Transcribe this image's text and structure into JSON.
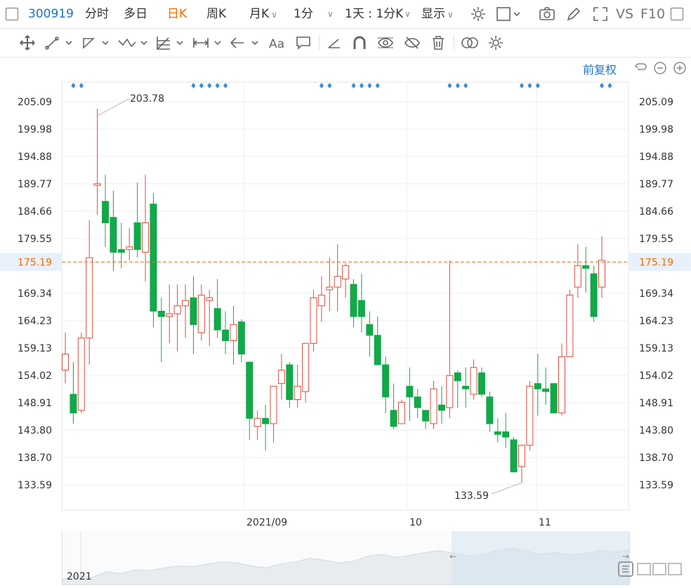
{
  "toolbar": {
    "code": "300919",
    "tabs": [
      "分时",
      "多日",
      "日K",
      "周K",
      "月K"
    ],
    "active_tab": "日K",
    "interval": "1分",
    "period": "1天 : 1分K",
    "display": "显示",
    "vs": "VS",
    "f10": "F10"
  },
  "adjust_label": "前复权",
  "icons": {
    "row1": [
      "settings-icon",
      "square-icon",
      "camera-icon",
      "pencil-icon",
      "expand-icon"
    ],
    "row2": [
      "move-icon",
      "line-tool-icon",
      "polyline-tool-icon",
      "wave-tool-icon",
      "fib-tool-icon",
      "measure-tool-icon",
      "arrow-tool-icon",
      "text-tool-icon",
      "comment-tool-icon",
      "ruler-icon",
      "magnet-icon",
      "eye-icon",
      "hide-icon",
      "trash-icon",
      "link-icon",
      "gear-icon"
    ]
  },
  "colors": {
    "up": "#e04a3f",
    "down": "#13a84a",
    "current": "#f56a00",
    "dots": "#2a8ff0"
  },
  "chart_data": {
    "type": "candlestick",
    "y_ticks": [
      "205.09",
      "199.98",
      "194.88",
      "189.77",
      "184.66",
      "179.55",
      "169.34",
      "164.23",
      "159.13",
      "154.02",
      "148.91",
      "143.80",
      "138.70",
      "133.59"
    ],
    "ylim": [
      133.59,
      205.09
    ],
    "current_price": "175.19",
    "x_labels": [
      "2021/09",
      "10",
      "11"
    ],
    "nav_year": "2021",
    "max_annotation": "203.78",
    "min_annotation": "133.59",
    "candles": [
      [
        155,
        158,
        162,
        152.5
      ],
      [
        150.5,
        147,
        156.5,
        145
      ],
      [
        147.5,
        161,
        162,
        147
      ],
      [
        161,
        176,
        183,
        156
      ],
      [
        189.5,
        189.8,
        203.8,
        184
      ],
      [
        186.5,
        182.5,
        191.5,
        178
      ],
      [
        183.5,
        177,
        188.5,
        173.5
      ],
      [
        177.5,
        177,
        182.5,
        174
      ],
      [
        177.5,
        178,
        181.5,
        175.5
      ],
      [
        182.5,
        177.5,
        190,
        176
      ],
      [
        177,
        182.5,
        191.5,
        171.5
      ],
      [
        186,
        166,
        188,
        163
      ],
      [
        166,
        165,
        168.5,
        156.5
      ],
      [
        165,
        165.5,
        171,
        160
      ],
      [
        165.5,
        167,
        171,
        158.5
      ],
      [
        167,
        168,
        171,
        161
      ],
      [
        168.5,
        163.5,
        172.5,
        158
      ],
      [
        162,
        169,
        171,
        160.5
      ],
      [
        168,
        168.5,
        170,
        159.5
      ],
      [
        166.5,
        162.5,
        172,
        161
      ],
      [
        162.5,
        160.5,
        166,
        158
      ],
      [
        160.5,
        163.5,
        167,
        156
      ],
      [
        164,
        158,
        164.5,
        156.5
      ],
      [
        156.5,
        146,
        156.5,
        142
      ],
      [
        144.5,
        146,
        147.5,
        142
      ],
      [
        146,
        145,
        148.5,
        140
      ],
      [
        145,
        152,
        152,
        141.5
      ],
      [
        152.5,
        155,
        158,
        149.5
      ],
      [
        156,
        149.5,
        156.5,
        148
      ],
      [
        149.5,
        152,
        156,
        148
      ],
      [
        151,
        160,
        160,
        149
      ],
      [
        160,
        168.5,
        170,
        158.5
      ],
      [
        167,
        169,
        172.5,
        164
      ],
      [
        170,
        170.5,
        176,
        166
      ],
      [
        170.5,
        172.5,
        178.5,
        166
      ],
      [
        172,
        174.5,
        175,
        168.5
      ],
      [
        171,
        165,
        172,
        163
      ],
      [
        168,
        165,
        173,
        162
      ],
      [
        163.5,
        161.5,
        166,
        157.5
      ],
      [
        161.5,
        156,
        165,
        156
      ],
      [
        156,
        150,
        157.5,
        147
      ],
      [
        147.5,
        144.5,
        152.5,
        144
      ],
      [
        145,
        149,
        149.5,
        145
      ],
      [
        152,
        150,
        155.5,
        145.5
      ],
      [
        150,
        148,
        151.5,
        146
      ],
      [
        147.5,
        145.5,
        147.5,
        144
      ],
      [
        145,
        151.5,
        153,
        144
      ],
      [
        148.5,
        147.5,
        152,
        145
      ],
      [
        148,
        154,
        175.5,
        146
      ],
      [
        154.5,
        153,
        155,
        148
      ],
      [
        152,
        151.5,
        155.5,
        148
      ],
      [
        150.5,
        155.5,
        157,
        149.5
      ],
      [
        154.5,
        150.5,
        155.5,
        150
      ],
      [
        150,
        145,
        151,
        143.5
      ],
      [
        143.5,
        143,
        146,
        141.5
      ],
      [
        143.5,
        142.5,
        147,
        140.5
      ],
      [
        142,
        136,
        142.5,
        136
      ],
      [
        137,
        141,
        141,
        134
      ],
      [
        141,
        152,
        153,
        140
      ],
      [
        152.5,
        151.5,
        158,
        146.5
      ],
      [
        151.5,
        151,
        155.5,
        148.5
      ],
      [
        152.5,
        147,
        152.5,
        147
      ],
      [
        147,
        157.5,
        160,
        146.5
      ],
      [
        157.5,
        169,
        170,
        158
      ],
      [
        170.5,
        174.5,
        178.5,
        168.5
      ],
      [
        174.5,
        174,
        178,
        169.5
      ],
      [
        173,
        165,
        174.5,
        164
      ],
      [
        170.5,
        175.5,
        180,
        168.5
      ]
    ],
    "signal_dots": [
      2,
      5,
      2,
      4,
      3,
      3,
      2
    ],
    "nav_series": [
      0.15,
      0.25,
      0.2,
      0.35,
      0.3,
      0.4,
      0.38,
      0.45,
      0.5,
      0.48,
      0.55,
      0.6,
      0.58,
      0.5,
      0.45,
      0.55,
      0.6,
      0.7,
      0.65,
      0.58,
      0.62,
      0.75,
      0.8,
      0.72,
      0.78,
      0.85,
      0.9,
      0.82,
      0.76,
      0.8,
      0.9,
      0.95,
      0.88,
      0.8,
      0.85,
      0.78,
      0.82,
      0.9,
      0.85,
      0.92
    ]
  }
}
